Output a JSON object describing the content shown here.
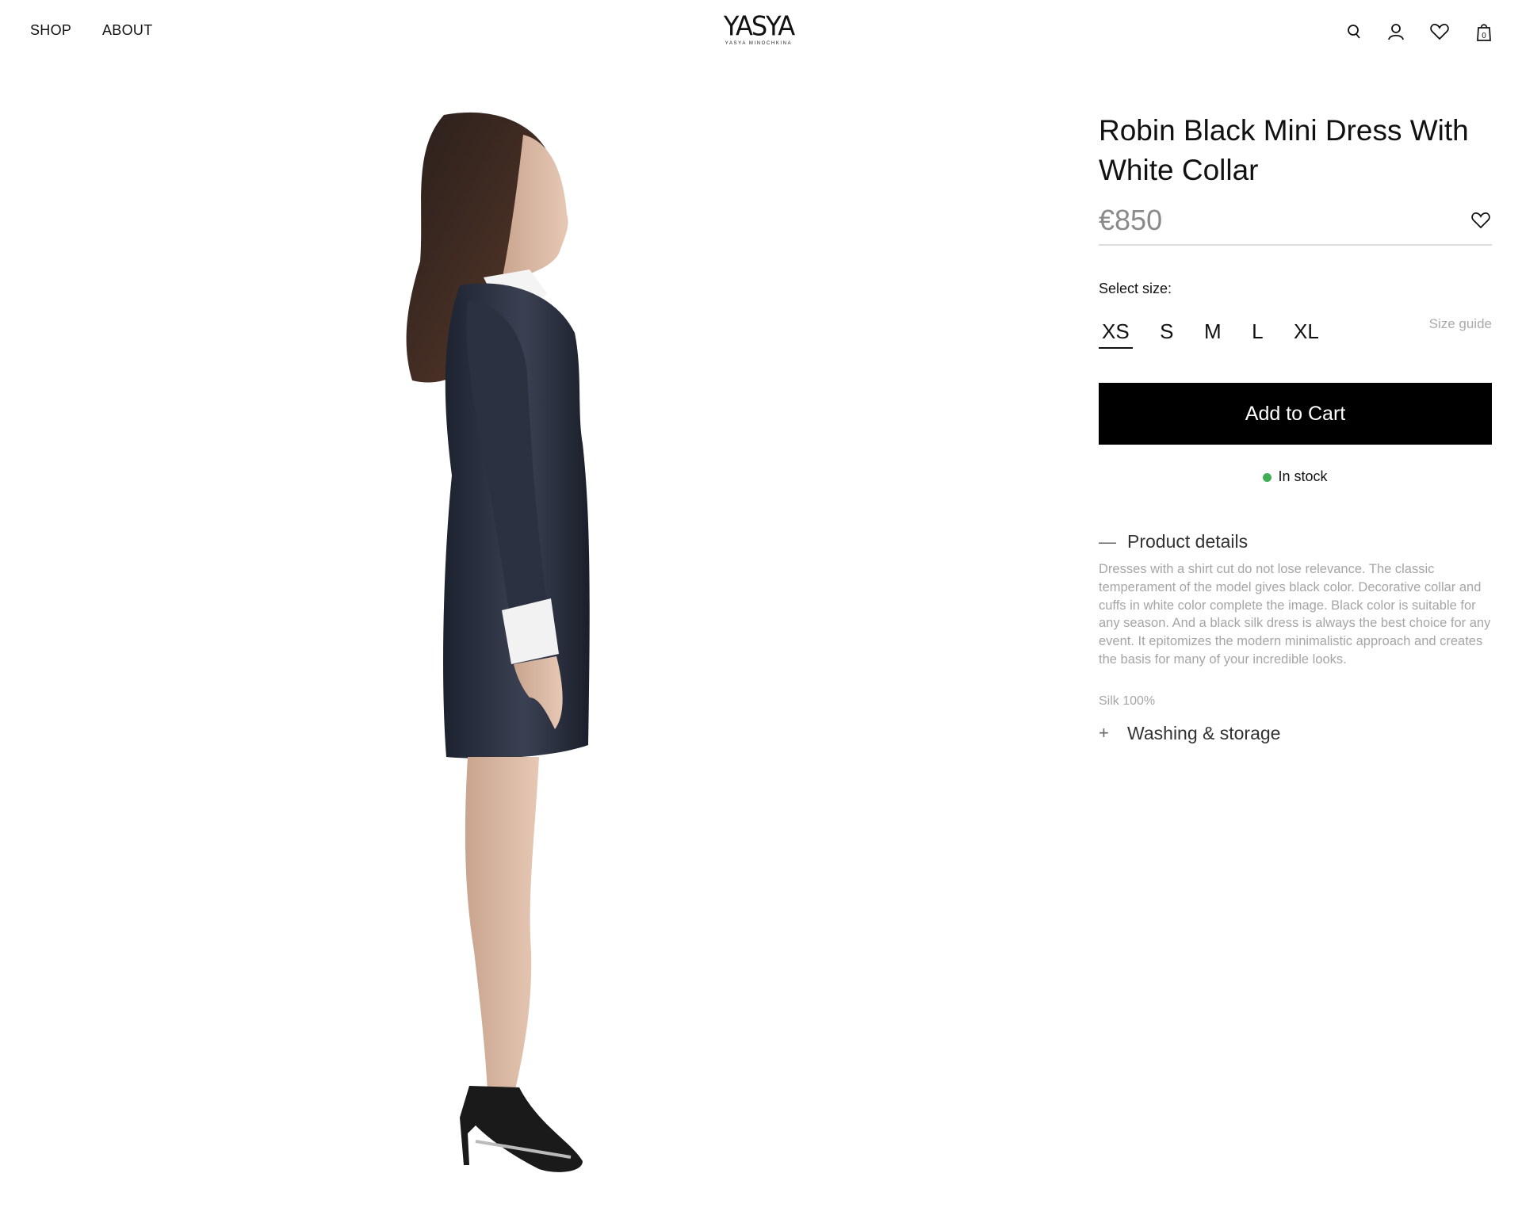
{
  "nav": {
    "shop": "SHOP",
    "about": "ABOUT"
  },
  "logo": {
    "mark": "YASYA",
    "sub": "YASYA MINOCHKINA"
  },
  "header_icons": [
    "search-icon",
    "user-icon",
    "heart-icon",
    "bag-icon"
  ],
  "cart_count": "0",
  "product": {
    "title": "Robin Black Mini Dress With White Collar",
    "price": "€850",
    "select_size_label": "Select size:",
    "sizes": [
      "XS",
      "S",
      "M",
      "L",
      "XL"
    ],
    "selected_size": "XS",
    "size_guide": "Size guide",
    "add_to_cart": "Add to Cart",
    "stock_status": "In stock",
    "stock_color": "#3fae54",
    "details_heading": "Product details",
    "details_text": "Dresses with a shirt cut do not lose relevance. The classic temperament of the model gives black color. Decorative collar and cuffs in white color complete the image. Black color is suitable for any season. And a black silk dress is always the best choice for any event. It epitomizes the modern minimalistic approach and creates the basis for many of your incredible looks.",
    "composition": "Silk 100%",
    "washing_heading": "Washing & storage"
  },
  "colors": {
    "price": "#8a8a8a",
    "cta_bg": "#000000",
    "muted_text": "#a5a5a5"
  }
}
